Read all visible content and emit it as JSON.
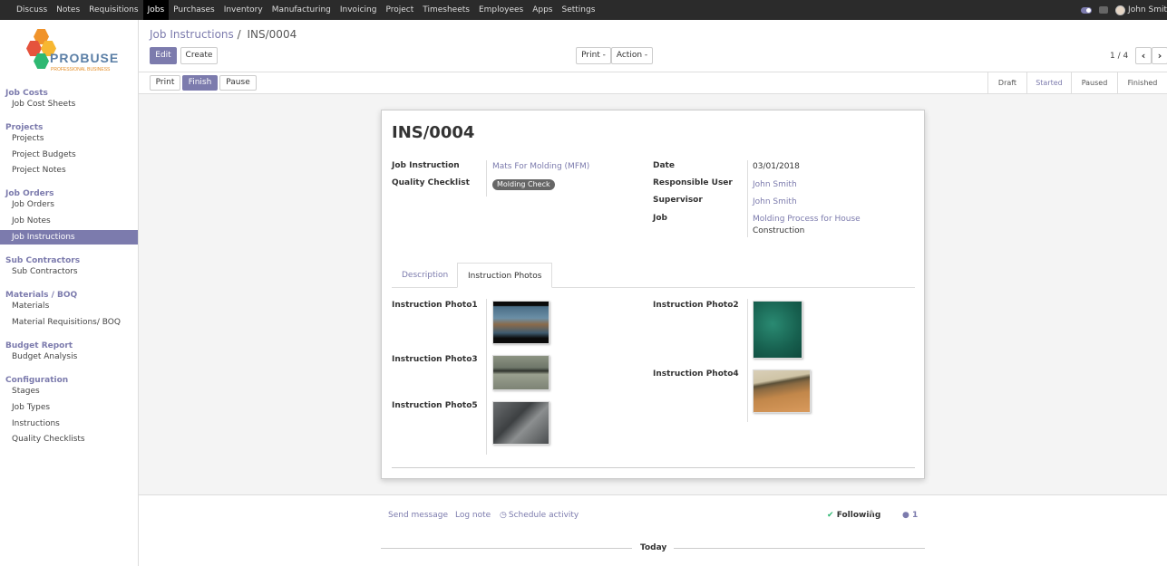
{
  "topnav": {
    "items": [
      "Discuss",
      "Notes",
      "Requisitions",
      "Jobs",
      "Purchases",
      "Inventory",
      "Manufacturing",
      "Invoicing",
      "Project",
      "Timesheets",
      "Employees",
      "Apps",
      "Settings"
    ],
    "active": "Jobs",
    "user": "John Smit"
  },
  "logo": {
    "word": "PROBUSE",
    "subtitle": "PROFESSIONAL BUSINESS"
  },
  "sidebar": {
    "sections": [
      {
        "title": "Job Costs",
        "items": [
          "Job Cost Sheets"
        ]
      },
      {
        "title": "Projects",
        "items": [
          "Projects",
          "Project Budgets",
          "Project Notes"
        ]
      },
      {
        "title": "Job Orders",
        "items": [
          "Job Orders",
          "Job Notes",
          "Job Instructions"
        ]
      },
      {
        "title": "Sub Contractors",
        "items": [
          "Sub Contractors"
        ]
      },
      {
        "title": "Materials / BOQ",
        "items": [
          "Materials",
          "Material Requisitions/ BOQ"
        ]
      },
      {
        "title": "Budget Report",
        "items": [
          "Budget Analysis"
        ]
      },
      {
        "title": "Configuration",
        "items": [
          "Stages",
          "Job Types",
          "Instructions",
          "Quality Checklists"
        ]
      }
    ],
    "active_item": "Job Instructions"
  },
  "breadcrumb": {
    "parent": "Job Instructions",
    "separator": "/",
    "current": "INS/0004"
  },
  "buttons": {
    "edit": "Edit",
    "create": "Create",
    "print_menu": "Print -",
    "action_menu": "Action -",
    "print": "Print",
    "finish": "Finish",
    "pause": "Pause"
  },
  "pager": {
    "text": "1 / 4",
    "prev": "‹",
    "next": "›"
  },
  "stages": [
    "Draft",
    "Started",
    "Paused",
    "Finished"
  ],
  "current_stage": "Started",
  "record": {
    "title": "INS/0004",
    "fields": {
      "job_instruction_label": "Job Instruction",
      "job_instruction": "Mats For Molding (MFM)",
      "quality_checklist_label": "Quality Checklist",
      "quality_checklist_tag": "Molding Check",
      "date_label": "Date",
      "date": "03/01/2018",
      "responsible_label": "Responsible User",
      "responsible": "John Smith",
      "supervisor_label": "Supervisor",
      "supervisor": "John Smith",
      "job_label": "Job",
      "job_line1": "Molding Process for House",
      "job_line2": "Construction"
    },
    "tabs": [
      "Description",
      "Instruction Photos"
    ],
    "active_tab": "Instruction Photos",
    "photos": {
      "p1": "Instruction Photo1",
      "p2": "Instruction Photo2",
      "p3": "Instruction Photo3",
      "p4": "Instruction Photo4",
      "p5": "Instruction Photo5"
    }
  },
  "chatter": {
    "send_message": "Send message",
    "log_note": "Log note",
    "schedule_activity": "Schedule activity",
    "following": "Following",
    "followers": "1",
    "today": "Today"
  }
}
